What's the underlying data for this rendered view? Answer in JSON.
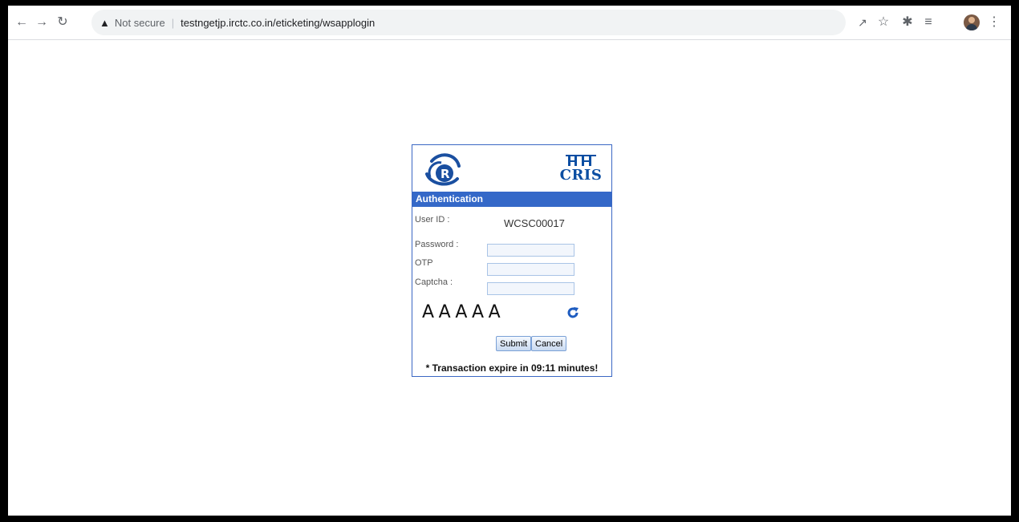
{
  "browser": {
    "security_label": "Not secure",
    "url": "testngetjp.irctc.co.in/eticketing/wsapplogin"
  },
  "auth": {
    "header": "Authentication",
    "user_id_label": "User ID :",
    "user_id_value": "WCSC00017",
    "password_label": "Password :",
    "otp_label": "OTP",
    "captcha_label": "Captcha :",
    "captcha_text": "AAAAA",
    "submit_label": "Submit",
    "cancel_label": "Cancel",
    "expire_message": "* Transaction expire in 09:11 minutes!",
    "cris_label": "CRIS"
  },
  "icons": {
    "back": "back-arrow-icon",
    "forward": "forward-arrow-icon",
    "reload": "reload-icon",
    "warning": "warning-icon",
    "share": "share-icon",
    "star": "star-icon",
    "extensions": "puzzle-icon",
    "reading_list": "reading-list-icon",
    "menu": "kebab-menu-icon",
    "captcha_refresh": "refresh-icon"
  },
  "colors": {
    "header_blue": "#3468c8",
    "border_blue": "#3b68c4",
    "cris_blue": "#0b4ea2"
  }
}
